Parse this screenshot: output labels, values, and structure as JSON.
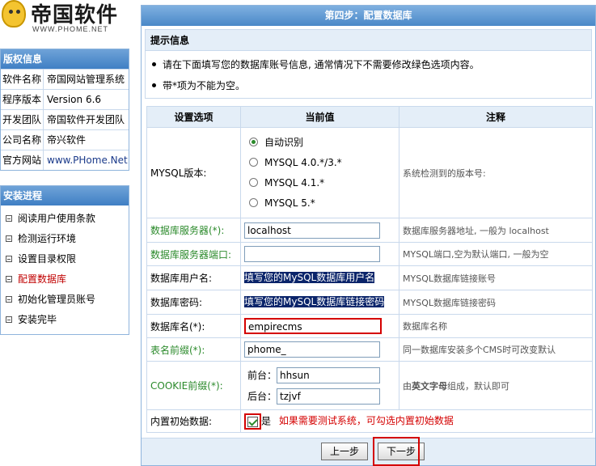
{
  "logo": {
    "name": "帝国软件",
    "url": "WWW.PHOME.NET"
  },
  "info": {
    "title": "版权信息",
    "rows": [
      {
        "key": "软件名称",
        "value": "帝国网站管理系统"
      },
      {
        "key": "程序版本",
        "value": "Version 6.6"
      },
      {
        "key": "开发团队",
        "value": "帝国软件开发团队"
      },
      {
        "key": "公司名称",
        "value": "帝兴软件"
      },
      {
        "key": "官方网站",
        "value": "www.PHome.Net"
      }
    ]
  },
  "progress": {
    "title": "安装进程",
    "steps": [
      "阅读用户使用条款",
      "检测运行环境",
      "设置目录权限",
      "配置数据库",
      "初始化管理员账号",
      "安装完毕"
    ],
    "current_index": 3
  },
  "main": {
    "title": "第四步：配置数据库",
    "tips_title": "提示信息",
    "tips": [
      "请在下面填写您的数据库账号信息, 通常情况下不需要修改绿色选项内容。",
      "带*项为不能为空。"
    ],
    "columns": {
      "option": "设置选项",
      "value": "当前值",
      "note": "注释"
    },
    "mysql": {
      "label": "MYSQL版本:",
      "options": [
        "自动识别",
        "MYSQL 4.0.*/3.*",
        "MYSQL 4.1.*",
        "MYSQL 5.*"
      ],
      "selected_index": 0,
      "note": "系统检测到的版本号:"
    },
    "host": {
      "label": "数据库服务器(*):",
      "value": "localhost",
      "note": "数据库服务器地址, 一般为  localhost"
    },
    "port": {
      "label": "数据库服务器端口:",
      "value": "",
      "note": "MYSQL端口,空为默认端口, 一般为空"
    },
    "user": {
      "label": "数据库用户名:",
      "value": "填写您的MySQL数据库用户名",
      "note": "MYSQL数据库链接账号"
    },
    "password": {
      "label": "数据库密码:",
      "value": "填写您的MySQL数据库链接密码",
      "note": "MYSQL数据库链接密码"
    },
    "dbname": {
      "label": "数据库名(*):",
      "value": "empirecms",
      "note": "数据库名称"
    },
    "prefix": {
      "label": "表名前缀(*):",
      "value": "phome_",
      "note": "同一数据库安装多个CMS时可改变默认"
    },
    "cookie": {
      "label": "COOKIE前缀(*):",
      "front_label": "前台：",
      "front_value": "hhsun",
      "back_label": "后台：",
      "back_value": "tzjvf",
      "note_prefix": "由",
      "note_bold": "英文字母",
      "note_suffix": "组成，默认即可"
    },
    "initdata": {
      "label": "内置初始数据:",
      "checkbox_label": "是",
      "checked": true,
      "hint": "如果需要测试系统，可勾选内置初始数据"
    },
    "buttons": {
      "prev": "上一步",
      "next": "下一步"
    }
  },
  "colors": {
    "header_blue": "#4a88c8",
    "green_label": "#2b8a2b",
    "highlight_red": "#d40000"
  }
}
